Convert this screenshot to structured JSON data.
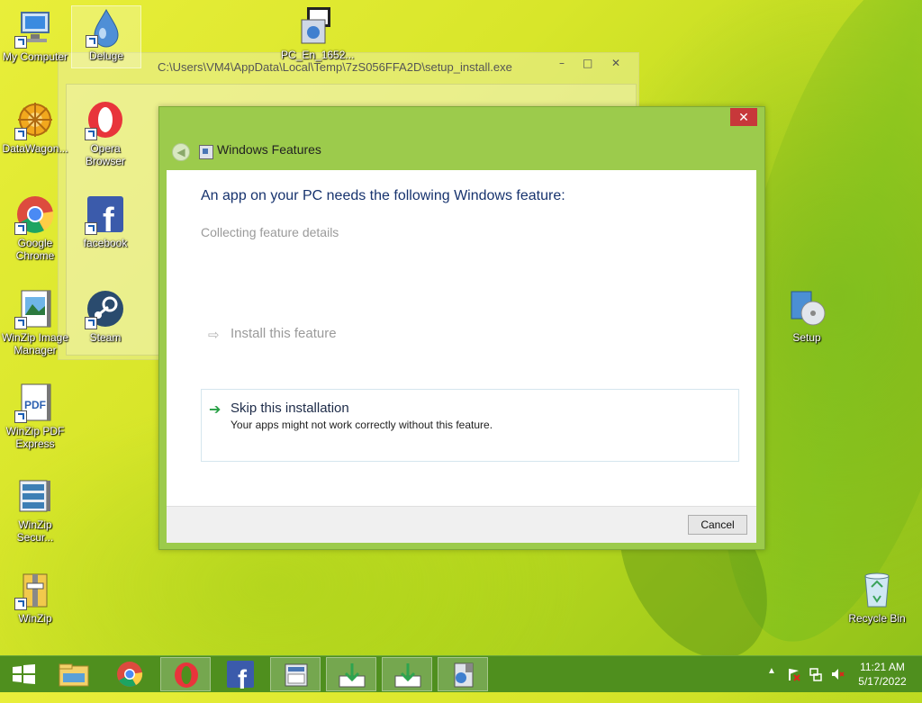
{
  "desktop": {
    "icons": [
      {
        "label": "My Computer",
        "icon": "computer-icon"
      },
      {
        "label": "Deluge",
        "icon": "deluge-icon"
      },
      {
        "label": "PC_En_1652...",
        "icon": "installer-icon"
      },
      {
        "label": "DataWagon...",
        "icon": "datawagon-icon"
      },
      {
        "label": "Opera Browser",
        "icon": "opera-icon"
      },
      {
        "label": "Google Chrome",
        "icon": "chrome-icon"
      },
      {
        "label": "facebook",
        "icon": "facebook-icon"
      },
      {
        "label": "WinZip Image Manager",
        "icon": "winzip-image-icon"
      },
      {
        "label": "Steam",
        "icon": "steam-icon"
      },
      {
        "label": "WinZip PDF Express",
        "icon": "pdf-icon"
      },
      {
        "label": "WinZip Secur...",
        "icon": "winzip-secure-icon"
      },
      {
        "label": "WinZip",
        "icon": "winzip-icon"
      },
      {
        "label": "Setup",
        "icon": "setup-icon"
      },
      {
        "label": "Recycle Bin",
        "icon": "recycle-bin-icon"
      }
    ]
  },
  "background_window": {
    "title": "C:\\Users\\VM4\\AppData\\Local\\Temp\\7zS056FFA2D\\setup_install.exe",
    "controls": [
      "–",
      "□",
      "✕"
    ]
  },
  "dialog": {
    "title": "Windows Features",
    "close_label": "✕",
    "heading": "An app on your PC needs the following Windows feature:",
    "status": "Collecting feature details",
    "install_option": "Install this feature",
    "skip_option": {
      "title": "Skip this installation",
      "description": "Your apps might not work correctly without this feature."
    },
    "cancel_label": "Cancel"
  },
  "taskbar": {
    "items": [
      "start-icon",
      "file-explorer-icon",
      "chrome-icon",
      "opera-icon",
      "facebook-icon",
      "app-window-icon",
      "download-icon",
      "download-icon",
      "installer-icon"
    ],
    "clock": {
      "time": "11:21 AM",
      "date": "5/17/2022"
    },
    "tray": [
      "show-hidden-icons-icon",
      "action-center-icon",
      "network-icon",
      "volume-muted-icon"
    ]
  },
  "colors": {
    "taskbar": "#4f8f1e",
    "dialog_frame": "#9ccb4c",
    "close_button": "#c7383a",
    "heading_text": "#17336e"
  }
}
